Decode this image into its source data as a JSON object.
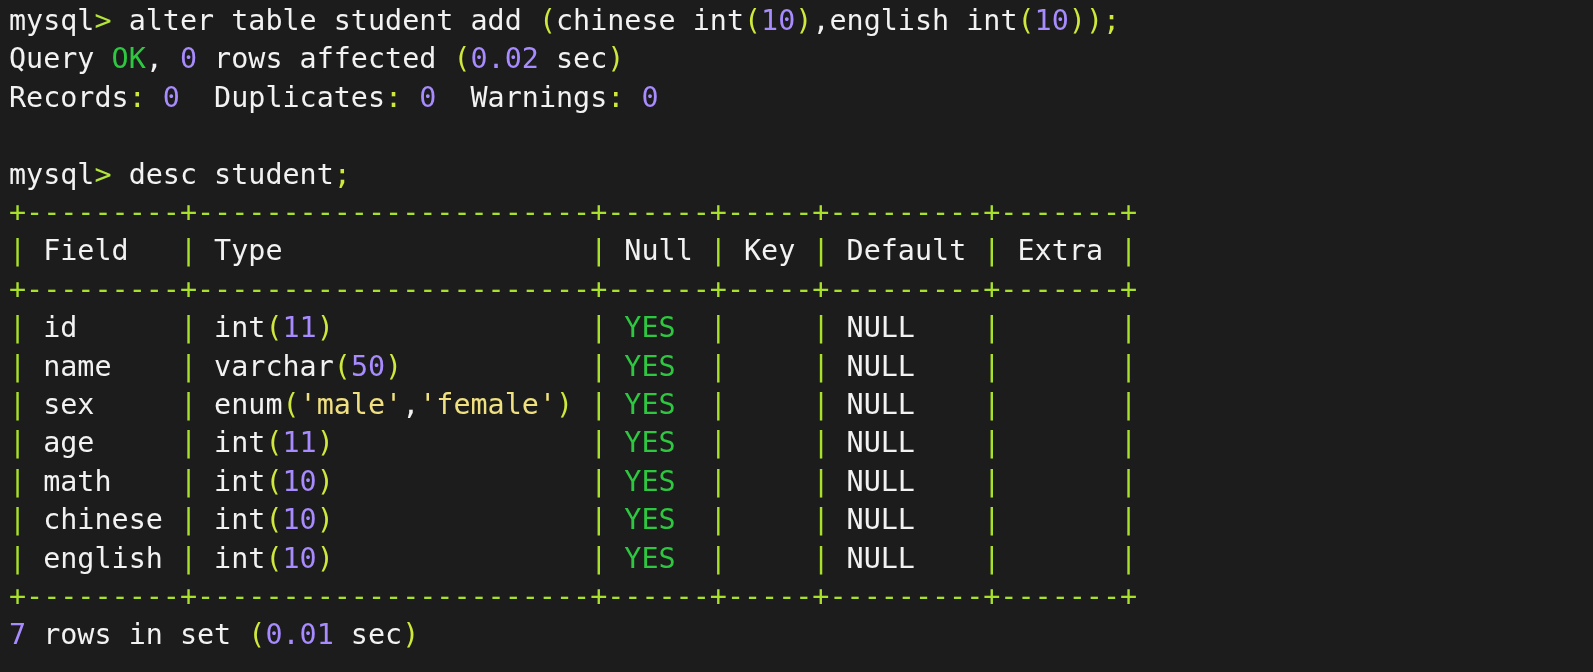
{
  "terminal": {
    "lines": [
      {
        "kind": "output",
        "segments": [
          {
            "text": "mysql",
            "kind": "plain"
          },
          {
            "text": ">",
            "kind": "prompt"
          },
          {
            "text": " alter table student add ",
            "kind": "plain"
          },
          {
            "text": "(",
            "kind": "punct"
          },
          {
            "text": "chinese int",
            "kind": "plain"
          },
          {
            "text": "(",
            "kind": "punct"
          },
          {
            "text": "10",
            "kind": "number"
          },
          {
            "text": ")",
            "kind": "punct"
          },
          {
            "text": ",english int",
            "kind": "plain"
          },
          {
            "text": "(",
            "kind": "punct"
          },
          {
            "text": "10",
            "kind": "number"
          },
          {
            "text": "));",
            "kind": "punct"
          }
        ]
      },
      {
        "kind": "output",
        "segments": [
          {
            "text": "Query ",
            "kind": "plain"
          },
          {
            "text": "OK",
            "kind": "ok"
          },
          {
            "text": ", ",
            "kind": "plain"
          },
          {
            "text": "0",
            "kind": "number"
          },
          {
            "text": " rows affected ",
            "kind": "plain"
          },
          {
            "text": "(",
            "kind": "punct"
          },
          {
            "text": "0.02",
            "kind": "number"
          },
          {
            "text": " sec",
            "kind": "plain"
          },
          {
            "text": ")",
            "kind": "punct"
          }
        ]
      },
      {
        "kind": "output",
        "segments": [
          {
            "text": "Records",
            "kind": "plain"
          },
          {
            "text": ":",
            "kind": "punct"
          },
          {
            "text": " 0",
            "kind": "number"
          },
          {
            "text": "  Duplicates",
            "kind": "plain"
          },
          {
            "text": ":",
            "kind": "punct"
          },
          {
            "text": " 0",
            "kind": "number"
          },
          {
            "text": "  Warnings",
            "kind": "plain"
          },
          {
            "text": ":",
            "kind": "punct"
          },
          {
            "text": " 0",
            "kind": "number"
          }
        ]
      },
      {
        "kind": "blank"
      },
      {
        "kind": "output",
        "segments": [
          {
            "text": "mysql",
            "kind": "plain"
          },
          {
            "text": ">",
            "kind": "prompt"
          },
          {
            "text": " desc student",
            "kind": "plain"
          },
          {
            "text": ";",
            "kind": "punct"
          }
        ]
      },
      {
        "kind": "border",
        "segments": [
          {
            "text": "+---------+-----------------------+------+-----+---------+-------+",
            "kind": "border"
          }
        ]
      },
      {
        "kind": "output",
        "segments": [
          {
            "text": "|",
            "kind": "border"
          },
          {
            "text": " Field   ",
            "kind": "plain"
          },
          {
            "text": "|",
            "kind": "border"
          },
          {
            "text": " Type                  ",
            "kind": "plain"
          },
          {
            "text": "|",
            "kind": "border"
          },
          {
            "text": " Null ",
            "kind": "plain"
          },
          {
            "text": "|",
            "kind": "border"
          },
          {
            "text": " Key ",
            "kind": "plain"
          },
          {
            "text": "|",
            "kind": "border"
          },
          {
            "text": " Default ",
            "kind": "plain"
          },
          {
            "text": "|",
            "kind": "border"
          },
          {
            "text": " Extra ",
            "kind": "plain"
          },
          {
            "text": "|",
            "kind": "border"
          }
        ]
      },
      {
        "kind": "border",
        "segments": [
          {
            "text": "+---------+-----------------------+------+-----+---------+-------+",
            "kind": "border"
          }
        ]
      },
      {
        "kind": "output",
        "segments": [
          {
            "text": "|",
            "kind": "border"
          },
          {
            "text": " id      ",
            "kind": "plain"
          },
          {
            "text": "|",
            "kind": "border"
          },
          {
            "text": " int",
            "kind": "plain"
          },
          {
            "text": "(",
            "kind": "punct"
          },
          {
            "text": "11",
            "kind": "number"
          },
          {
            "text": ")",
            "kind": "punct"
          },
          {
            "text": "               |",
            "kind": "border"
          },
          {
            "text": " YES  ",
            "kind": "yes"
          },
          {
            "text": "|     |",
            "kind": "border"
          },
          {
            "text": " NULL    ",
            "kind": "plain"
          },
          {
            "text": "|       |",
            "kind": "border"
          }
        ]
      },
      {
        "kind": "output",
        "segments": [
          {
            "text": "|",
            "kind": "border"
          },
          {
            "text": " name    ",
            "kind": "plain"
          },
          {
            "text": "|",
            "kind": "border"
          },
          {
            "text": " varchar",
            "kind": "plain"
          },
          {
            "text": "(",
            "kind": "punct"
          },
          {
            "text": "50",
            "kind": "number"
          },
          {
            "text": ")",
            "kind": "punct"
          },
          {
            "text": "           |",
            "kind": "border"
          },
          {
            "text": " YES  ",
            "kind": "yes"
          },
          {
            "text": "|     |",
            "kind": "border"
          },
          {
            "text": " NULL    ",
            "kind": "plain"
          },
          {
            "text": "|       |",
            "kind": "border"
          }
        ]
      },
      {
        "kind": "output",
        "segments": [
          {
            "text": "|",
            "kind": "border"
          },
          {
            "text": " sex     ",
            "kind": "plain"
          },
          {
            "text": "|",
            "kind": "border"
          },
          {
            "text": " enum",
            "kind": "plain"
          },
          {
            "text": "(",
            "kind": "punct"
          },
          {
            "text": "'male'",
            "kind": "string"
          },
          {
            "text": ",",
            "kind": "plain"
          },
          {
            "text": "'female'",
            "kind": "string"
          },
          {
            "text": ")",
            "kind": "punct"
          },
          {
            "text": " |",
            "kind": "border"
          },
          {
            "text": " YES  ",
            "kind": "yes"
          },
          {
            "text": "|     |",
            "kind": "border"
          },
          {
            "text": " NULL    ",
            "kind": "plain"
          },
          {
            "text": "|       |",
            "kind": "border"
          }
        ]
      },
      {
        "kind": "output",
        "segments": [
          {
            "text": "|",
            "kind": "border"
          },
          {
            "text": " age     ",
            "kind": "plain"
          },
          {
            "text": "|",
            "kind": "border"
          },
          {
            "text": " int",
            "kind": "plain"
          },
          {
            "text": "(",
            "kind": "punct"
          },
          {
            "text": "11",
            "kind": "number"
          },
          {
            "text": ")",
            "kind": "punct"
          },
          {
            "text": "               |",
            "kind": "border"
          },
          {
            "text": " YES  ",
            "kind": "yes"
          },
          {
            "text": "|     |",
            "kind": "border"
          },
          {
            "text": " NULL    ",
            "kind": "plain"
          },
          {
            "text": "|       |",
            "kind": "border"
          }
        ]
      },
      {
        "kind": "output",
        "segments": [
          {
            "text": "|",
            "kind": "border"
          },
          {
            "text": " math    ",
            "kind": "plain"
          },
          {
            "text": "|",
            "kind": "border"
          },
          {
            "text": " int",
            "kind": "plain"
          },
          {
            "text": "(",
            "kind": "punct"
          },
          {
            "text": "10",
            "kind": "number"
          },
          {
            "text": ")",
            "kind": "punct"
          },
          {
            "text": "               |",
            "kind": "border"
          },
          {
            "text": " YES  ",
            "kind": "yes"
          },
          {
            "text": "|     |",
            "kind": "border"
          },
          {
            "text": " NULL    ",
            "kind": "plain"
          },
          {
            "text": "|       |",
            "kind": "border"
          }
        ]
      },
      {
        "kind": "output",
        "segments": [
          {
            "text": "|",
            "kind": "border"
          },
          {
            "text": " chinese ",
            "kind": "plain"
          },
          {
            "text": "|",
            "kind": "border"
          },
          {
            "text": " int",
            "kind": "plain"
          },
          {
            "text": "(",
            "kind": "punct"
          },
          {
            "text": "10",
            "kind": "number"
          },
          {
            "text": ")",
            "kind": "punct"
          },
          {
            "text": "               |",
            "kind": "border"
          },
          {
            "text": " YES  ",
            "kind": "yes"
          },
          {
            "text": "|     |",
            "kind": "border"
          },
          {
            "text": " NULL    ",
            "kind": "plain"
          },
          {
            "text": "|       |",
            "kind": "border"
          }
        ]
      },
      {
        "kind": "output",
        "segments": [
          {
            "text": "|",
            "kind": "border"
          },
          {
            "text": " english ",
            "kind": "plain"
          },
          {
            "text": "|",
            "kind": "border"
          },
          {
            "text": " int",
            "kind": "plain"
          },
          {
            "text": "(",
            "kind": "punct"
          },
          {
            "text": "10",
            "kind": "number"
          },
          {
            "text": ")",
            "kind": "punct"
          },
          {
            "text": "               |",
            "kind": "border"
          },
          {
            "text": " YES  ",
            "kind": "yes"
          },
          {
            "text": "|     |",
            "kind": "border"
          },
          {
            "text": " NULL    ",
            "kind": "plain"
          },
          {
            "text": "|       |",
            "kind": "border"
          }
        ]
      },
      {
        "kind": "border",
        "segments": [
          {
            "text": "+---------+-----------------------+------+-----+---------+-------+",
            "kind": "border"
          }
        ]
      },
      {
        "kind": "output",
        "segments": [
          {
            "text": "7",
            "kind": "number"
          },
          {
            "text": " rows in set ",
            "kind": "plain"
          },
          {
            "text": "(",
            "kind": "punct"
          },
          {
            "text": "0.01",
            "kind": "number"
          },
          {
            "text": " sec",
            "kind": "plain"
          },
          {
            "text": ")",
            "kind": "punct"
          }
        ]
      }
    ]
  }
}
